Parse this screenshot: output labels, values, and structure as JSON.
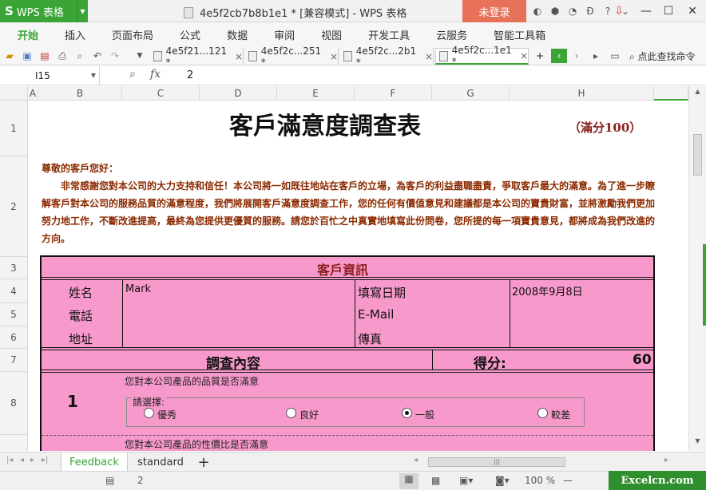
{
  "app": {
    "name": "WPS 表格",
    "window_title": "4e5f2cb7b8b1e1 * [兼容模式] - WPS 表格",
    "login_label": "未登录"
  },
  "menu": [
    "开始",
    "插入",
    "页面布局",
    "公式",
    "数据",
    "审阅",
    "视图",
    "开发工具",
    "云服务",
    "智能工具箱"
  ],
  "doc_tabs": [
    {
      "label": "4e5f21...121 *",
      "close": "×"
    },
    {
      "label": "4e5f2c...251 *",
      "close": "×"
    },
    {
      "label": "4e5f2c...2b1 *",
      "close": "×"
    },
    {
      "label": "4e5f2c...1e1 *",
      "close": "×"
    }
  ],
  "find_label": "点此查找命令",
  "formula": {
    "cell_ref": "I15",
    "fx": "fx",
    "value": "2"
  },
  "columns": [
    "A",
    "B",
    "C",
    "D",
    "E",
    "F",
    "G",
    "H"
  ],
  "rows": [
    "1",
    "2",
    "3",
    "4",
    "5",
    "6",
    "7",
    "8"
  ],
  "sheet": {
    "title": "客戶滿意度調查表",
    "score_max": "（滿分100）",
    "greeting": "尊敬的客戶您好：",
    "intro": "非常感謝您對本公司的大力支持和信任！本公司將一如既往地站在客戶的立場，為客戶的利益盡職盡責，爭取客戶最大的滿意。為了進一步瞭解客戶對本公司的服務品質的滿意程度，我們將展開客戶滿意度調查工作，您的任何有價值意見和建議都是本公司的寶貴財富，並將激勵我們更加努力地工作，不斷改進提高，最終為您提供更優質的服務。請您於百忙之中真實地填寫此份問卷，您所提的每一項寶貴意見，都將成為我們改進的方向。",
    "customer_section": "客戶資訊",
    "labels": {
      "name": "姓名",
      "phone": "電話",
      "address": "地址",
      "date": "填寫日期",
      "email": "E-Mail",
      "fax": "傳真"
    },
    "values": {
      "name": "Mark",
      "date": "2008年9月8日"
    },
    "survey_header": "調查內容",
    "score_label": "得分:",
    "score_value": "60",
    "q1": {
      "number": "1",
      "text": "您對本公司產品的品質是否滿意",
      "group_label": "請選擇:",
      "options": [
        "優秀",
        "良好",
        "一般",
        "較差"
      ],
      "selected": "一般"
    },
    "q2_text": "您對本公司產品的性價比是否滿意"
  },
  "sheet_tabs": [
    "Feedback",
    "standard"
  ],
  "active_sheet": "Feedback",
  "status": {
    "page": "2",
    "zoom": "100 %"
  },
  "watermark": "Excelcn.com",
  "colors": {
    "brand_green": "#3aa536",
    "pink": "#f799cb",
    "login": "#e8715a"
  }
}
